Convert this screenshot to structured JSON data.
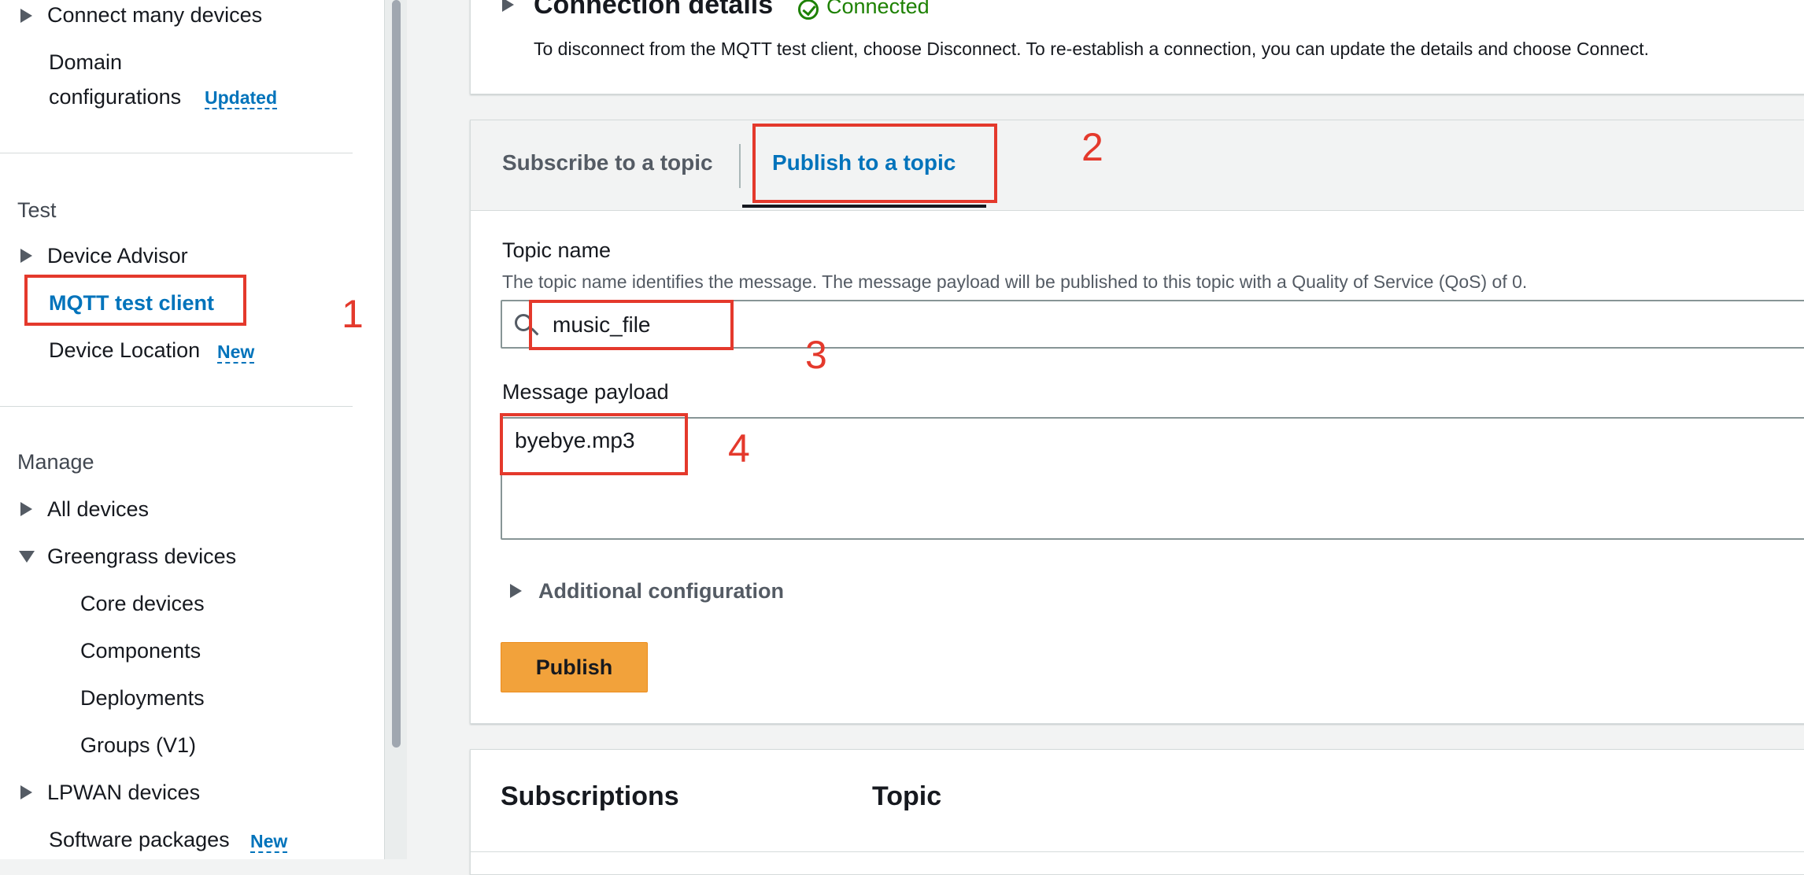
{
  "sidebar": {
    "items_top": [
      {
        "label": "Connect many devices"
      }
    ],
    "domain_config": {
      "line1": "Domain",
      "line2": "configurations",
      "badge": "Updated"
    },
    "test_section": {
      "title": "Test",
      "items": [
        {
          "label": "Device Advisor"
        },
        {
          "label": "MQTT test client"
        },
        {
          "label": "Device Location",
          "badge": "New"
        }
      ]
    },
    "manage_section": {
      "title": "Manage",
      "items": [
        {
          "label": "All devices"
        },
        {
          "label": "Greengrass devices"
        },
        {
          "label": "Core devices"
        },
        {
          "label": "Components"
        },
        {
          "label": "Deployments"
        },
        {
          "label": "Groups (V1)"
        },
        {
          "label": "LPWAN devices"
        },
        {
          "label": "Software packages",
          "badge": "New"
        }
      ]
    }
  },
  "connection": {
    "title": "Connection details",
    "status": "Connected",
    "description": "To disconnect from the MQTT test client, choose Disconnect. To re-establish a connection, you can update the details and choose Connect."
  },
  "tabs": [
    {
      "label": "Subscribe to a topic"
    },
    {
      "label": "Publish to a topic"
    }
  ],
  "publish": {
    "topic_label": "Topic name",
    "topic_help": "The topic name identifies the message. The message payload will be published to this topic with a Quality of Service (QoS) of 0.",
    "topic_value": "music_file",
    "payload_label": "Message payload",
    "payload_value": "byebye.mp3",
    "additional_config": "Additional configuration",
    "publish_button": "Publish"
  },
  "subscriptions": {
    "title": "Subscriptions",
    "topic_header": "Topic"
  },
  "annotations": [
    "1",
    "2",
    "3",
    "4"
  ],
  "colors": {
    "accent": "#0073bb",
    "annotation": "#e4392c",
    "primary_button": "#f2a23b",
    "connected": "#1d8102"
  }
}
